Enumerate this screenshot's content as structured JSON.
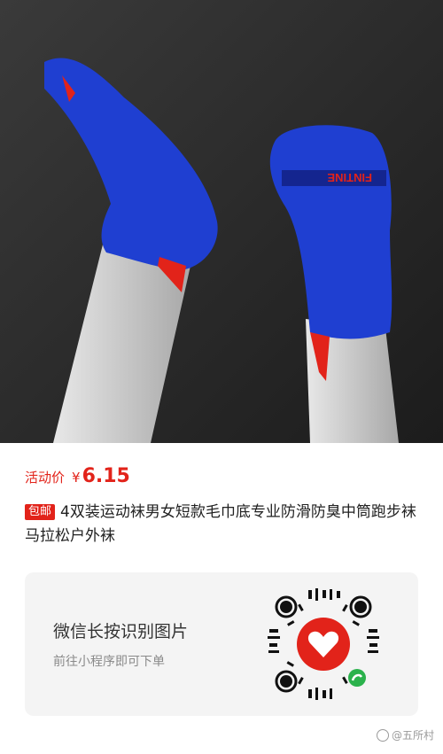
{
  "hero": {
    "image_name": "product-photo-socks",
    "sock_print": "FINTINE"
  },
  "price": {
    "label": "活动价",
    "currency": "¥",
    "value": "6.15"
  },
  "product": {
    "badge": "包邮",
    "title": "4双装运动袜男女短款毛巾底专业防滑防臭中筒跑步袜马拉松户外袜"
  },
  "share_card": {
    "title": "微信长按识别图片",
    "subtitle": "前往小程序即可下单",
    "qr_icon": "wechat-mini-program-qr-icon"
  },
  "watermark": {
    "text": "@五所村"
  },
  "colors": {
    "accent": "#e2231a",
    "sock_blue": "#1f3fd1",
    "background_dark": "#2a2a2a"
  }
}
